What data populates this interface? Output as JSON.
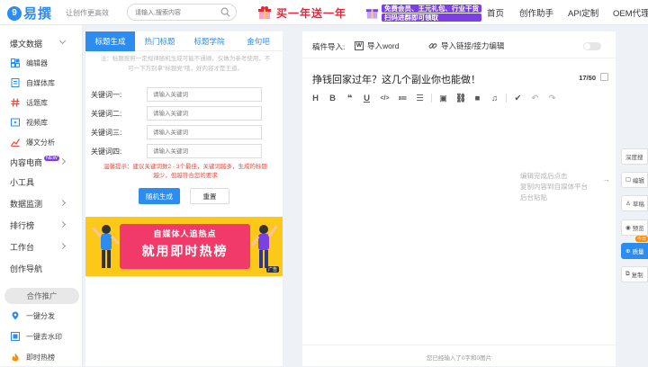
{
  "header": {
    "logo_mark": "9",
    "logo_text": "易撰",
    "slogan": "让创作更高效",
    "search_placeholder": "请输入,搜索内容",
    "promo1_text": "买一年送一年",
    "promo2_line1": "免费会员、王元礼包、行业干货",
    "promo2_line2": "扫码进群即可领取",
    "nav": [
      "首页",
      "创作助手",
      "API定制",
      "OEM代理"
    ]
  },
  "sidebar": {
    "groups": [
      {
        "label": "爆文数据",
        "chevron": "down"
      },
      {
        "label": "内容电商",
        "badge": "NEW",
        "chevron": "right"
      },
      {
        "label": "小工具"
      },
      {
        "label": "数据监测",
        "chevron": "right"
      },
      {
        "label": "排行榜",
        "chevron": "right"
      },
      {
        "label": "工作台",
        "chevron": "right"
      },
      {
        "label": "创作导航"
      }
    ],
    "subitems": [
      {
        "label": "编辑器",
        "icon": "grid-icon"
      },
      {
        "label": "自媒体库",
        "icon": "document-icon"
      },
      {
        "label": "话题库",
        "icon": "hashtag-icon"
      },
      {
        "label": "视频库",
        "icon": "video-icon"
      },
      {
        "label": "爆文分析",
        "icon": "chart-icon"
      }
    ],
    "promo_pill": "合作推广",
    "bottom_items": [
      {
        "label": "一键分发",
        "icon": "location-icon"
      },
      {
        "label": "一键去水印",
        "icon": "image-icon"
      },
      {
        "label": "即时热榜",
        "icon": "flame-icon"
      }
    ]
  },
  "title_tool": {
    "tabs": [
      "标题生成",
      "热门标题",
      "标题学院",
      "金句吧"
    ],
    "active_tab": 0,
    "notice_line1": "注：标题按照一定规律随机生成可能不通顺，仅做为参考使用，不",
    "notice_line2": "可一下万别拿\"标题党\"哦，好内容才是王道。",
    "keyword_rows": [
      {
        "label": "关键词一:",
        "placeholder": "请输入关键词"
      },
      {
        "label": "关键词二:",
        "placeholder": "请输入关键词"
      },
      {
        "label": "关键词三:",
        "placeholder": "请输入关键词"
      },
      {
        "label": "关键词四:",
        "placeholder": "请输入关键词"
      }
    ],
    "warning_line1": "温馨提示：建议关键词数2 - 3个最佳，关键词越多，生成的标题",
    "warning_line2": "越少，但越符合您的要求",
    "generate_button": "随机生成",
    "reset_button": "重置",
    "banner_line1": "自媒体人追热点",
    "banner_line2": "就用即时热榜",
    "banner_tag": "广告"
  },
  "editor": {
    "import_label": "稿件导入:",
    "word_icon_letter": "W",
    "import_word": "导入word",
    "import_link": "导入链接/接力编辑",
    "title": "挣钱回家过年？这几个副业你也能做！",
    "char_count": "17/50",
    "toolbar": [
      {
        "glyph": "H",
        "name": "heading-icon"
      },
      {
        "glyph": "B",
        "name": "bold-icon"
      },
      {
        "glyph": "❝",
        "name": "quote-icon"
      },
      {
        "glyph": "U",
        "name": "underline-icon"
      },
      {
        "glyph": "</>",
        "name": "code-icon"
      },
      {
        "glyph": "≔",
        "name": "ordered-list-icon"
      },
      {
        "glyph": "☰",
        "name": "unordered-list-icon"
      },
      {
        "glyph": "▣",
        "name": "image-icon"
      },
      {
        "glyph": "⛓",
        "name": "link-icon"
      },
      {
        "glyph": "■",
        "name": "video-icon"
      },
      {
        "glyph": "♫",
        "name": "audio-icon"
      },
      {
        "glyph": "✔",
        "name": "check-icon"
      },
      {
        "glyph": "↶",
        "name": "undo-icon"
      },
      {
        "glyph": "↷",
        "name": "redo-icon"
      }
    ],
    "footer": "您已经输入了0字和0图片"
  },
  "right_hint": {
    "line1": "编辑完成后点击",
    "line2": "复制内容到自媒体平台",
    "line3": "后台粘贴"
  },
  "right_buttons": [
    {
      "label": "深度搜",
      "icon": ""
    },
    {
      "label": "编辑",
      "icon": "edit-icon"
    },
    {
      "label": "草稿",
      "icon": "draft-icon"
    },
    {
      "label": "预览",
      "icon": "eye-icon"
    },
    {
      "label": "质量",
      "icon": "quality-icon",
      "badge": "今日"
    },
    {
      "label": "复制",
      "icon": "copy-icon"
    }
  ],
  "colors": {
    "accent": "#2d8cf0",
    "promo_red": "#e6263a",
    "promo_purple": "#7b3fe4",
    "banner_yellow": "#fdc818",
    "banner_pink": "#f23a6a",
    "warning_red": "#e84a3c"
  }
}
